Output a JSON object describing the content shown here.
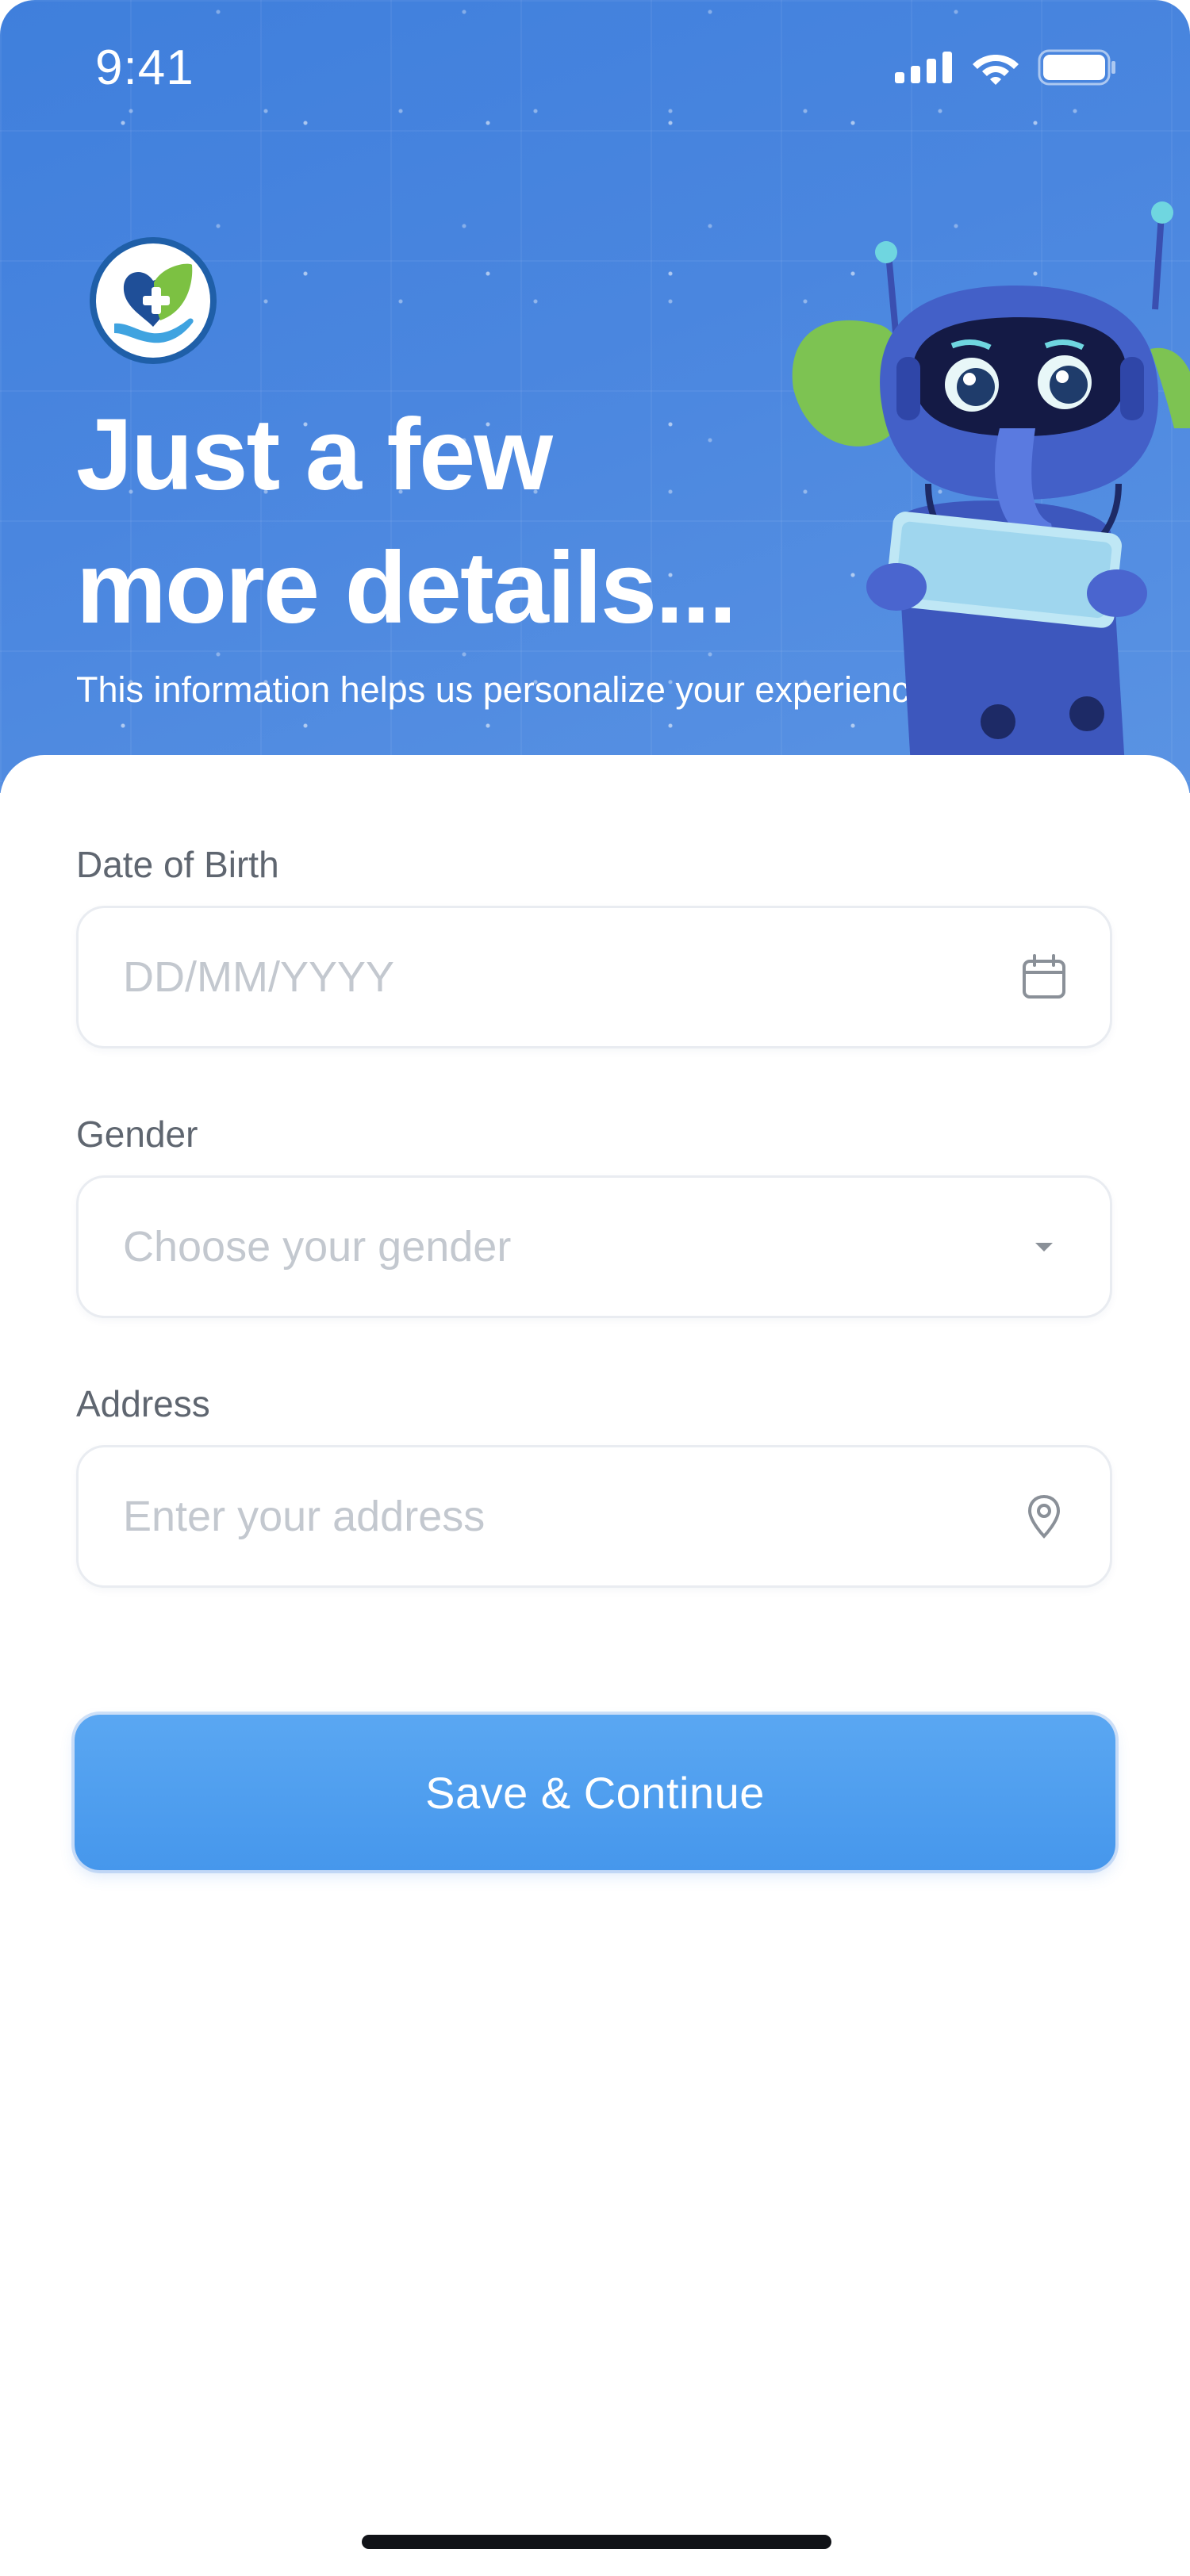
{
  "status_bar": {
    "time": "9:41",
    "icons": [
      "cellular-signal-icon",
      "wifi-icon",
      "battery-icon"
    ]
  },
  "hero": {
    "logo": "health-heart-hand-logo",
    "title_line1": "Just a few",
    "title_line2": "more details...",
    "subtitle": "This information helps us personalize your experience.",
    "illustration": "robot-elephant-doctor-with-tablet"
  },
  "form": {
    "dob": {
      "label": "Date of Birth",
      "placeholder": "DD/MM/YYYY",
      "value": "",
      "icon": "calendar-icon"
    },
    "gender": {
      "label": "Gender",
      "placeholder": "Choose your gender",
      "value": "",
      "icon": "caret-down-icon"
    },
    "address": {
      "label": "Address",
      "placeholder": "Enter your address",
      "value": "",
      "icon": "map-pin-icon"
    },
    "submit_label": "Save & Continue"
  },
  "colors": {
    "hero_background": "#4a86df",
    "button": "#4c9bef",
    "label": "#5f6670",
    "placeholder": "#c3c8cf",
    "field_border": "#e9ecf1"
  }
}
